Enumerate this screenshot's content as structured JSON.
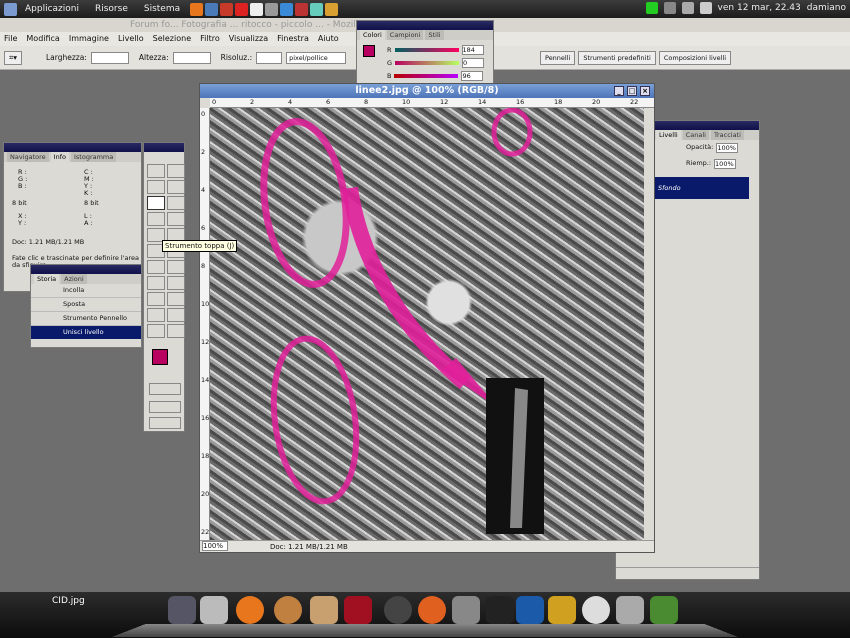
{
  "top_panel": {
    "menus": [
      "Applicazioni",
      "Risorse",
      "Sistema"
    ],
    "clock": "ven 12 mar, 22.43",
    "user": "damiano"
  },
  "firefox_bar": {
    "title": "Forum fo... Fotografia ... ritocco - piccolo ... - Mozilla Firefox"
  },
  "photoshop": {
    "menubar": [
      "File",
      "Modifica",
      "Immagine",
      "Livello",
      "Selezione",
      "Filtro",
      "Visualizza",
      "Finestra",
      "Aiuto"
    ],
    "options": {
      "width_label": "Larghezza:",
      "height_label": "Altezza:",
      "resolution_label": "Risoluz.:",
      "unit_value": "pixel/pollice",
      "right_tabs": [
        "Pennelli",
        "Strumenti predefiniti",
        "Composizioni livelli"
      ]
    },
    "color_palette": {
      "tabs": [
        "Colori",
        "Campioni",
        "Stili"
      ],
      "channels": [
        {
          "label": "R",
          "value": "184"
        },
        {
          "label": "G",
          "value": "0"
        },
        {
          "label": "B",
          "value": "96"
        }
      ],
      "foreground_color": "#b80060"
    },
    "info_palette": {
      "tabs": [
        "Navigatore",
        "Info",
        "Istogramma"
      ],
      "rgb_labels": [
        "R :",
        "G :",
        "B :"
      ],
      "cmyk_labels": [
        "C :",
        "M :",
        "Y :",
        "K :"
      ],
      "bits_left": "8 bit",
      "bits_right": "8 bit",
      "xy_labels": [
        "X :",
        "Y :"
      ],
      "lh_labels": [
        "L :",
        "A :"
      ],
      "doc_size": "Doc: 1.21 MB/1.21 MB",
      "hint": "Fate clic e trascinate per definire l'area da sfiguire..."
    },
    "history_palette": {
      "tabs": [
        "Storia",
        "Azioni"
      ],
      "items": [
        "Incolla",
        "Sposta",
        "Strumento Pennello",
        "Unisci livello"
      ],
      "selected_index": 3
    },
    "layers_palette": {
      "tabs": [
        "Livelli",
        "Canali",
        "Tracciati"
      ],
      "opacity_label": "Opacità:",
      "opacity_value": "100%",
      "fill_label": "Riemp.:",
      "fill_value": "100%",
      "layer_name": "Sfondo"
    },
    "tooltip": "Strumento toppa (J)",
    "document": {
      "title": "linee2.jpg @ 100% (RGB/8)",
      "zoom": "100%",
      "doc_size": "Doc: 1.21 MB/1.21 MB",
      "ruler_numbers": [
        "0",
        "2",
        "4",
        "6",
        "8",
        "10",
        "12",
        "14",
        "16",
        "18",
        "20",
        "22"
      ]
    }
  },
  "dock": {
    "desktop_label": "CID.jpg"
  },
  "colors": {
    "accent": "#e0209a",
    "selection": "#0a1a6a"
  }
}
